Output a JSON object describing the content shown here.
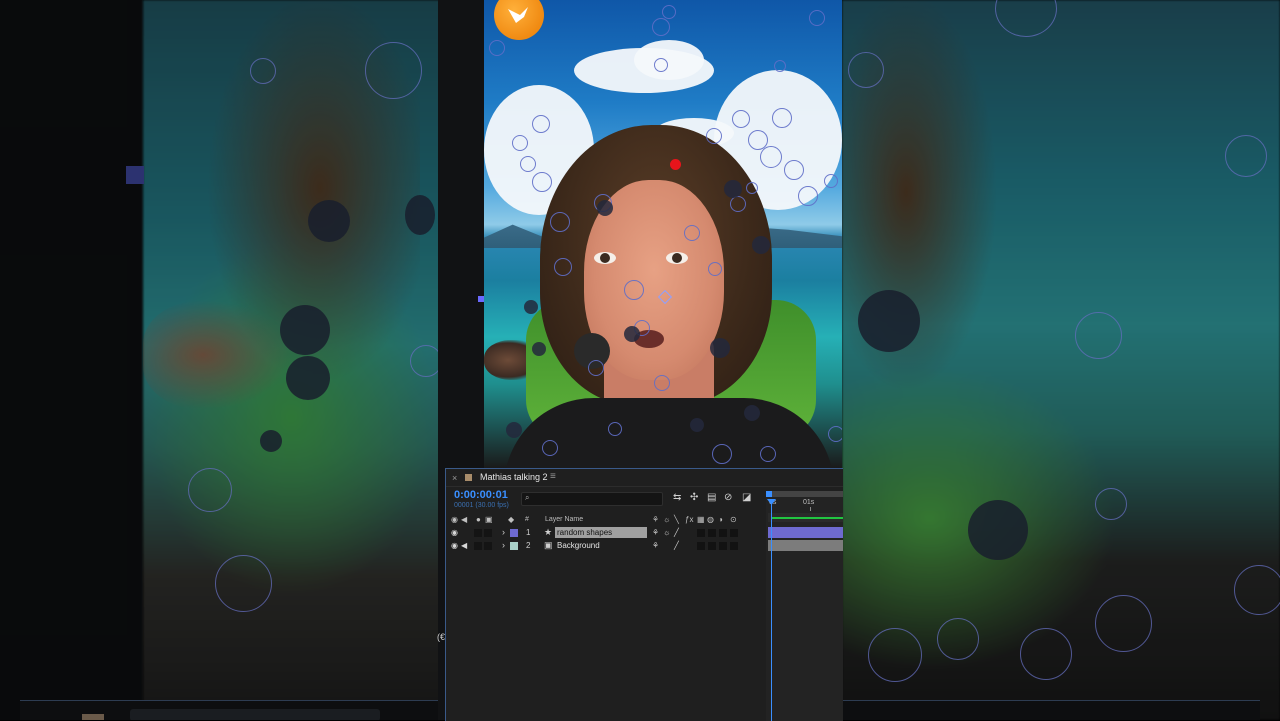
{
  "composition": {
    "tab_title": "Mathias talking 2",
    "tab_menu_icon": "hamburger-menu-icon",
    "close_glyph": "×",
    "timecode": "0:00:00:01",
    "frame_info": "00001 (30.00 fps)",
    "search_placeholder": ""
  },
  "columns": {
    "number_header": "#",
    "layer_name_header": "Layer Name"
  },
  "layers": [
    {
      "index": "1",
      "name": "random shapes",
      "type_icon": "star-shape-layer-icon",
      "type_glyph": "★",
      "label_color": "#6e6ad0",
      "selected": true
    },
    {
      "index": "2",
      "name": "Background",
      "type_icon": "footage-layer-icon",
      "type_glyph": "▣",
      "label_color": "#a8d0c8",
      "selected": false
    }
  ],
  "time_ruler": {
    "start_label": "0s",
    "second_label": "01s"
  },
  "video": {
    "logo_icon": "bird-logo-icon",
    "accent_red": "#e8141b",
    "ring_color": "#5f6ec8"
  },
  "side_label": "(€"
}
